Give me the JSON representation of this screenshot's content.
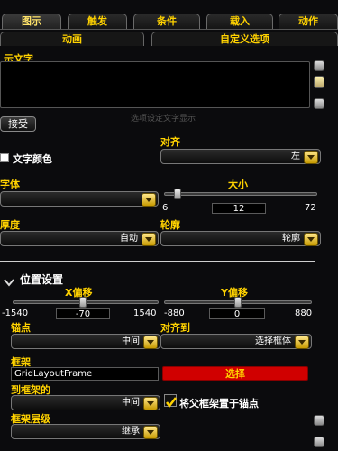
{
  "tabs": [
    "图示",
    "触发",
    "条件",
    "载入",
    "动作"
  ],
  "subtabs": [
    "动画",
    "自定义选项"
  ],
  "display_text": {
    "label": "示文字",
    "textarea_hint": "选项设定文字显示",
    "accept_button": "接受",
    "text_color_label": "文字颜色"
  },
  "justify": {
    "label": "对齐",
    "value": "左"
  },
  "font": {
    "label": "字体",
    "value": ""
  },
  "size": {
    "label": "大小",
    "min": "6",
    "value": "12",
    "max": "72",
    "fraction": 0.09
  },
  "outline_thickness": {
    "label": "厚度",
    "value": "自动"
  },
  "outline": {
    "label": "轮廓",
    "value": "轮廓"
  },
  "position_section": {
    "title": "位置设置"
  },
  "x_offset": {
    "label": "X偏移",
    "min": "-1540",
    "value": "-70",
    "max": "1540",
    "fraction": 0.48
  },
  "y_offset": {
    "label": "Y偏移",
    "min": "-880",
    "value": "0",
    "max": "880",
    "fraction": 0.5
  },
  "anchor": {
    "label": "锚点",
    "value": "中间"
  },
  "anchor_to": {
    "label": "对齐到",
    "value": "选择框体"
  },
  "frame": {
    "label": "框架",
    "value": "GridLayoutFrame",
    "select_button": "选择"
  },
  "frame_anchor": {
    "label": "到框架的",
    "value": "中间"
  },
  "set_parent": {
    "label": "将父框架置于锚点",
    "checked": true
  },
  "frame_strata": {
    "label": "框架层级",
    "value": "继承"
  },
  "colors": {
    "gold": "#ffd200",
    "red_button": "#d00000"
  }
}
